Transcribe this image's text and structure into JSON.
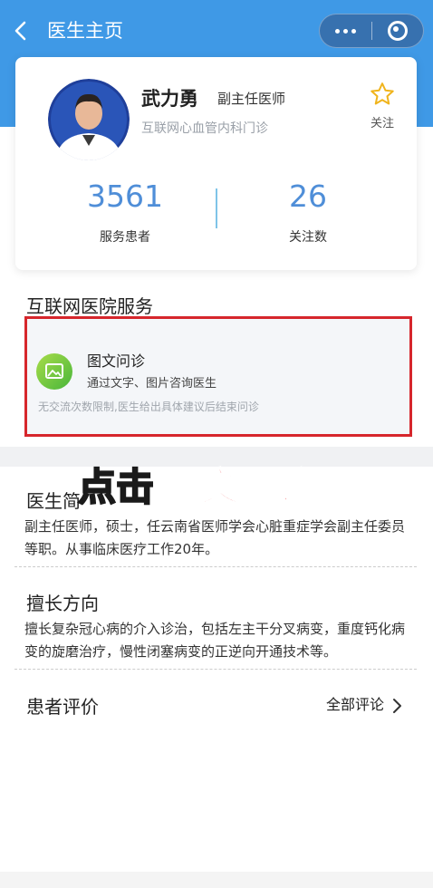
{
  "nav": {
    "title": "医生主页"
  },
  "doctor": {
    "name": "武力勇",
    "title": "副主任医师",
    "department": "互联网心血管内科门诊",
    "follow_label": "关注",
    "stats": [
      {
        "value": "3561",
        "label": "服务患者"
      },
      {
        "value": "26",
        "label": "关注数"
      }
    ]
  },
  "services": {
    "section_title": "互联网医院服务",
    "items": [
      {
        "name": "图文问诊",
        "description": "通过文字、图片咨询医生",
        "note": "无交流次数限制,医生给出具体建议后结束问诊"
      }
    ]
  },
  "overlay_instruction": {
    "part1": "点击",
    "part2": "图文问诊"
  },
  "profile": {
    "intro_title": "医生简",
    "intro_text": "副主任医师，硕士，任云南省医师学会心脏重症学会副主任委员等职。从事临床医疗工作20年。",
    "specialty_title": "擅长方向",
    "specialty_text": "擅长复杂冠心病的介入诊治，包括左主干分叉病变，重度钙化病变的旋磨治疗，慢性闭塞病变的正逆向开通技术等。"
  },
  "reviews": {
    "title": "患者评价",
    "all_label": "全部评论"
  },
  "colors": {
    "header_blue": "#3f99e6",
    "stat_blue": "#4f8ed8",
    "highlight_red": "#d6262c",
    "star_gold": "#f0b41c",
    "overlay_yellow": "#ffe600",
    "overlay_red": "#e8161d"
  },
  "icons": [
    "back-arrow-icon",
    "more-dots-icon",
    "close-target-icon",
    "star-icon",
    "image-icon",
    "chevron-right-icon"
  ]
}
